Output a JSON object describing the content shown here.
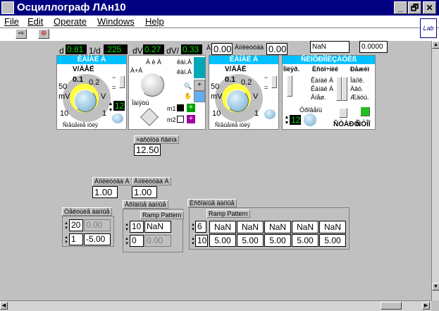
{
  "window": {
    "title": "Осциллограф ЛАн10",
    "btn_min": "_",
    "btn_max": "🗗",
    "btn_close": "✕"
  },
  "menu": {
    "file": "File",
    "edit": "Edit",
    "operate": "Operate",
    "windows": "Windows",
    "help": "Help"
  },
  "toolbar": {
    "run": "⇨",
    "stop": "⊛"
  },
  "lab_icon": "Lab",
  "top_strip": {
    "d_label": "d",
    "d_value": "0.81",
    "inv_label": "1/d",
    "inv_value": ".225",
    "dv_label": "dV",
    "dv_value": "0.27",
    "dvd_label": "dV/",
    "dvd_value": "0.33",
    "a_label": "Â",
    "a_value": "0.00",
    "mid_label": "Àìïëèòóäà",
    "mid_value": "0.00",
    "nan_value": "NaN",
    "right_value": "0.0000"
  },
  "channel_a": {
    "header": "ÊÀÍÀË  À",
    "units": "V/ÄÅË",
    "scale_top_left": "0.1",
    "scale_top_right": "0.2",
    "scale_50": "50",
    "scale_mv": "mV",
    "scale_v": "V",
    "scale_10": "10",
    "scale_1": "1",
    "ac_label": "~",
    "dc_label": "=",
    "offset_value": "12",
    "bottom_label": "Ñìåùåíèå íóëÿ"
  },
  "middle_panel": {
    "top_label": "À è Á",
    "a_plus": "À+Á",
    "lbl_a": "êàí.À",
    "lbl_b": "êàí.Á",
    "bottom_label": "Ïàìÿòü",
    "m1": "m1",
    "m2": "m2"
  },
  "channel_b": {
    "header": "ÊÀÍÀË  Á",
    "units": "V/ÄÅË",
    "scale_top_left": "0.1",
    "scale_top_right": "0.2",
    "scale_50": "50",
    "scale_mv": "mV",
    "scale_v": "V",
    "scale_10": "10",
    "scale_1": "1",
    "ac_label": "~",
    "dc_label": "=",
    "bottom_label": "Ñìåùåíèå íóëÿ"
  },
  "sync_panel": {
    "header": "ÑÈÍÕÐÎÍÈÇÀÖÈß",
    "col1": "Ïîëÿð.",
    "col2": "Èñòî÷íèê",
    "col3": "Ðåæèì",
    "src_a": "Êàíàë À",
    "src_b": "Êàíàë Á",
    "src_ext": "Âíåø.",
    "mode1": "Îäíîê.",
    "mode2": "Àâò.",
    "mode3": "Æäóù.",
    "level_label": "Óðîâåíü",
    "level_value": "12",
    "btn_start": "ÑÒÀÐÒ",
    "btn_stop": "ÑÒÎÏ"
  },
  "freq": {
    "label": "×àñòîòà ñâèïà",
    "value": "12.50"
  },
  "amp_a": {
    "label": "Àìïëèòóäà À",
    "value": "1.00"
  },
  "amp_b": {
    "label": "Àìïëèòóäà Á",
    "value": "1.00"
  },
  "arr1": {
    "label": "Òåêóùèå äàííûå",
    "idx1": "20",
    "idx2": "1",
    "v1": "0.00",
    "v2": "-5.00"
  },
  "arr2": {
    "label": "Âõîäíûå äàííûå",
    "cluster_label": "Ramp Pattern",
    "idx1": "10",
    "idx2": "0",
    "v1": "NaN",
    "v2": "0.00"
  },
  "arr3": {
    "label": "Èñõîäíûå äàííûå",
    "cluster_label": "Ramp Pattern",
    "idx1": "6",
    "idx2": "10",
    "row1": [
      "NaN",
      "NaN",
      "NaN",
      "NaN",
      "NaN"
    ],
    "row2": [
      "5.00",
      "5.00",
      "5.00",
      "5.00",
      "5.00"
    ]
  }
}
